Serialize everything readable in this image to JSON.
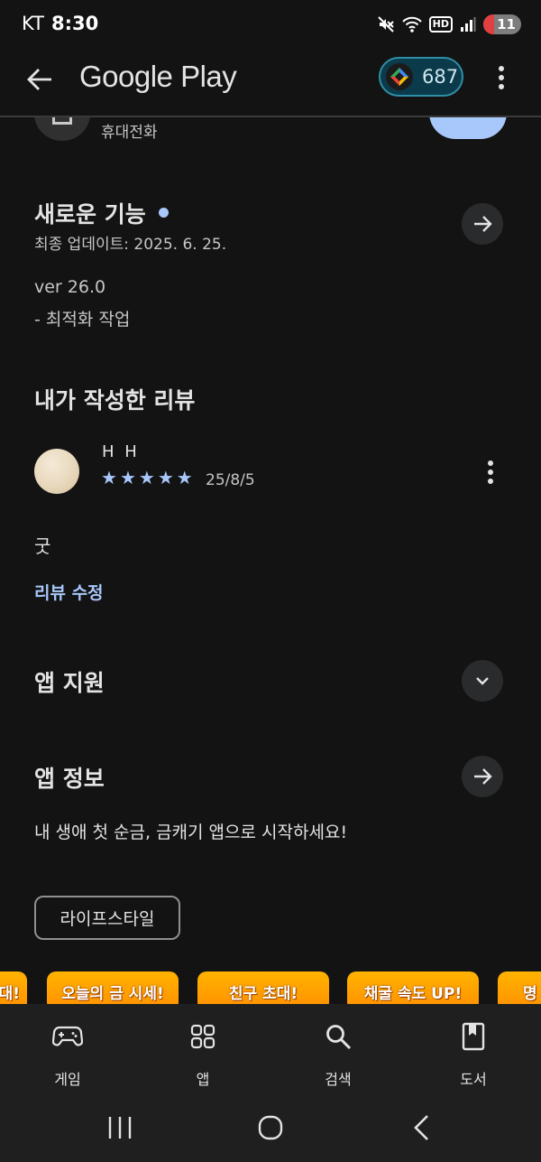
{
  "status": {
    "carrier": "KT",
    "time": "8:30",
    "hd": "HD",
    "battery": "11",
    "battery_level": 0.11
  },
  "app_bar": {
    "title": "Google Play",
    "points": "687"
  },
  "prev_section": {
    "subtitle": "휴대전화"
  },
  "whats_new": {
    "title": "새로운 기능",
    "updated": "최종 업데이트: 2025. 6. 25.",
    "version": "ver 26.0",
    "note": "- 최적화 작업"
  },
  "my_review": {
    "title": "내가 작성한 리뷰",
    "reviewer": "H H",
    "rating": 5,
    "date": "25/8/5",
    "text": "굿",
    "edit_label": "리뷰 수정"
  },
  "app_support": {
    "title": "앱 지원"
  },
  "app_info": {
    "title": "앱 정보",
    "description": "내 생애 첫 순금, 금캐기 앱으로 시작하세요!",
    "category": "라이프스타일"
  },
  "promos": [
    "대!",
    "오늘의 금 시세!",
    "친구 초대!",
    "채굴 속도 UP!",
    "명"
  ],
  "bottom_nav": [
    {
      "label": "게임",
      "icon": "gamepad-icon"
    },
    {
      "label": "앱",
      "icon": "apps-grid-icon"
    },
    {
      "label": "검색",
      "icon": "search-icon"
    },
    {
      "label": "도서",
      "icon": "book-icon"
    }
  ],
  "colors": {
    "accent": "#a8c7fa",
    "background": "#131313",
    "promo": "#ffa000"
  }
}
